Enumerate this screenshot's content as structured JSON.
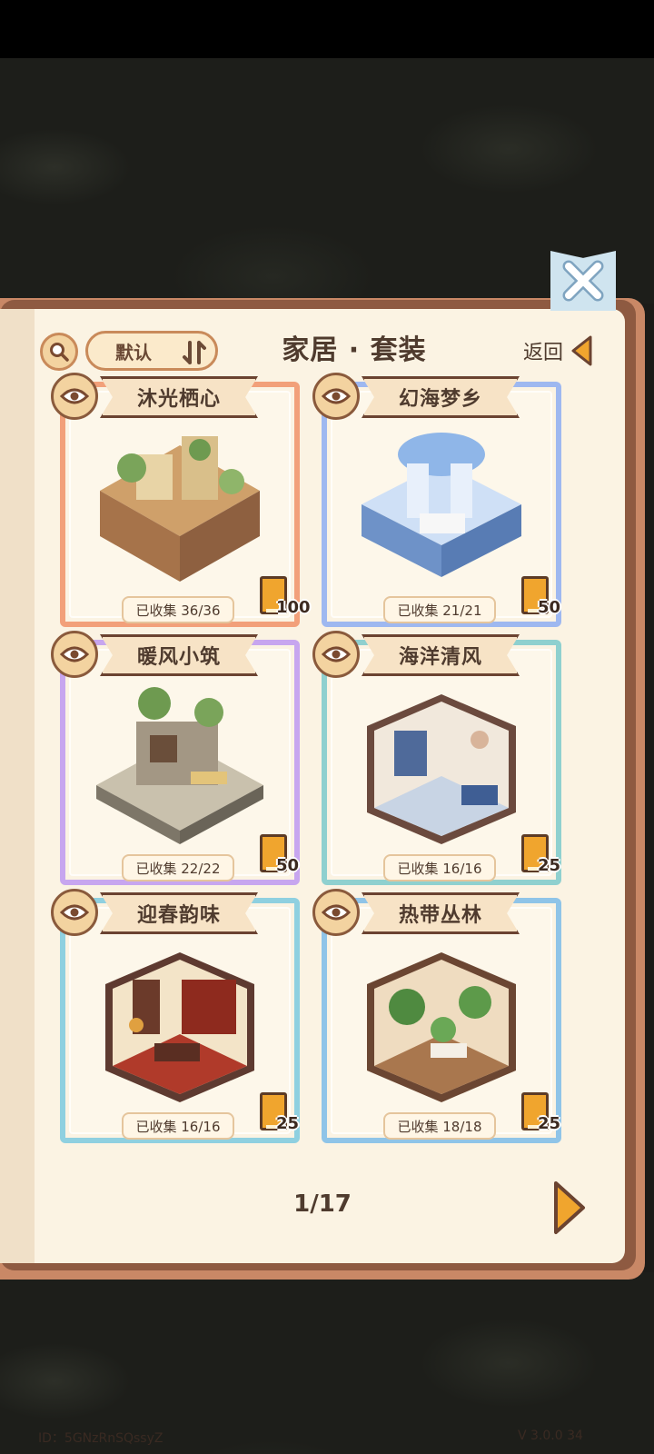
{
  "header": {
    "title": "家居 · 套装",
    "sort_label": "默认",
    "back_label": "返回"
  },
  "cards": [
    {
      "name": "沐光栖心",
      "collected": "已收集 36/36",
      "reward": "100",
      "frame_color": "#f2a07a"
    },
    {
      "name": "幻海梦乡",
      "collected": "已收集 21/21",
      "reward": "50",
      "frame_color": "#9eb8f0"
    },
    {
      "name": "暖风小筑",
      "collected": "已收集 22/22",
      "reward": "50",
      "frame_color": "#c7a6ef"
    },
    {
      "name": "海洋清风",
      "collected": "已收集 16/16",
      "reward": "25",
      "frame_color": "#8fd0cf"
    },
    {
      "name": "迎春韵味",
      "collected": "已收集 16/16",
      "reward": "25",
      "frame_color": "#8fd0e0"
    },
    {
      "name": "热带丛林",
      "collected": "已收集 18/18",
      "reward": "25",
      "frame_color": "#8fc4e8"
    }
  ],
  "pager": {
    "label": "1/17"
  },
  "footer": {
    "id_text": "ID：5GNzRnSQssyZ",
    "version": "V 3.0.0  34"
  },
  "icons": {
    "close": "close-icon",
    "search": "search-icon",
    "sort": "sort-icon",
    "back": "back-arrow-icon",
    "next": "next-arrow-icon",
    "eye": "eye-icon",
    "reward": "book-icon"
  }
}
